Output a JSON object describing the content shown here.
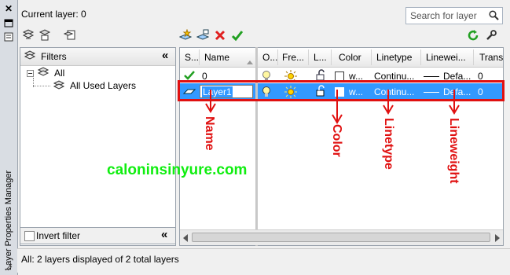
{
  "palette": {
    "title": "Layer Properties Manager"
  },
  "header": {
    "current_layer": "Current layer: 0",
    "search_placeholder": "Search for layer"
  },
  "filters": {
    "header": "Filters",
    "tree": [
      {
        "label": "All"
      },
      {
        "label": "All Used Layers"
      }
    ],
    "invert_label": "Invert filter"
  },
  "columns": [
    "S...",
    "Name",
    "O...",
    "Fre...",
    "L...",
    "Color",
    "Linetype",
    "Linewei...",
    "Trans..."
  ],
  "rows": [
    {
      "name": "0",
      "color": "w...",
      "linetype": "Continu...",
      "lineweight": "Defa...",
      "transparency": "0"
    },
    {
      "name": "Layer1",
      "color": "w...",
      "linetype": "Continu...",
      "lineweight": "Defa...",
      "transparency": "0"
    }
  ],
  "status": "All: 2 layers displayed of 2 total layers",
  "annotations": {
    "name": "Name",
    "color": "Color",
    "linetype": "Linetype",
    "lineweight": "Lineweight",
    "watermark": "caloninsinyure.com",
    "accent": "#e01010",
    "watermark_color": "#10ee10"
  },
  "colors": {
    "selection": "#3399ff",
    "panel_bg": "#f0f0f0"
  }
}
